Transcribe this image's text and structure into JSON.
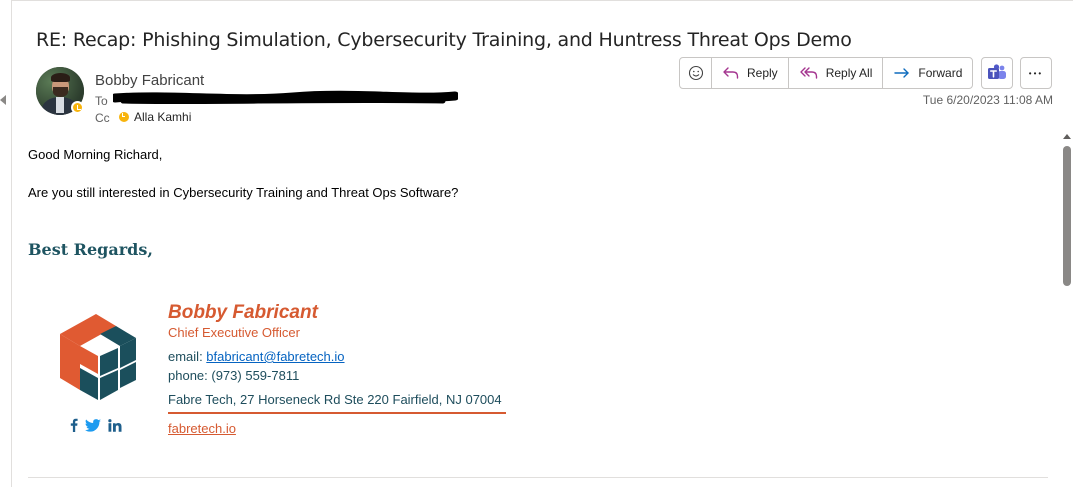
{
  "email": {
    "subject": "RE: Recap: Phishing Simulation, Cybersecurity Training, and Huntress Threat Ops Demo",
    "sender": "Bobby Fabricant",
    "to_label": "To",
    "cc_label": "Cc",
    "cc_name": "Alla Kamhi",
    "timestamp": "Tue 6/20/2023 11:08 AM"
  },
  "toolbar": {
    "reply_label": "Reply",
    "reply_all_label": "Reply All",
    "forward_label": "Forward",
    "more_label": "•••"
  },
  "body": {
    "greeting": "Good Morning Richard,",
    "message": "Are you still interested in Cybersecurity Training and Threat Ops Software?",
    "closing": "Best Regards,"
  },
  "signature": {
    "name": "Bobby Fabricant",
    "title": "Chief Executive Officer",
    "email_label": "email: ",
    "email": "bfabricant@fabretech.io",
    "phone_label": "phone: ",
    "phone": "(973) 559-7811",
    "address": "Fabre Tech, 27 Horseneck Rd Ste 220 Fairfield, NJ 07004",
    "website": "fabretech.io"
  },
  "colors": {
    "accent_orange": "#d65a31",
    "accent_teal": "#1e5461",
    "presence_away": "#f8b40c",
    "link_blue": "#0563c1"
  },
  "icons": [
    "emoji-icon",
    "reply-icon",
    "reply-all-icon",
    "forward-icon",
    "teams-icon",
    "more-icon",
    "facebook-icon",
    "twitter-icon",
    "linkedin-icon"
  ]
}
